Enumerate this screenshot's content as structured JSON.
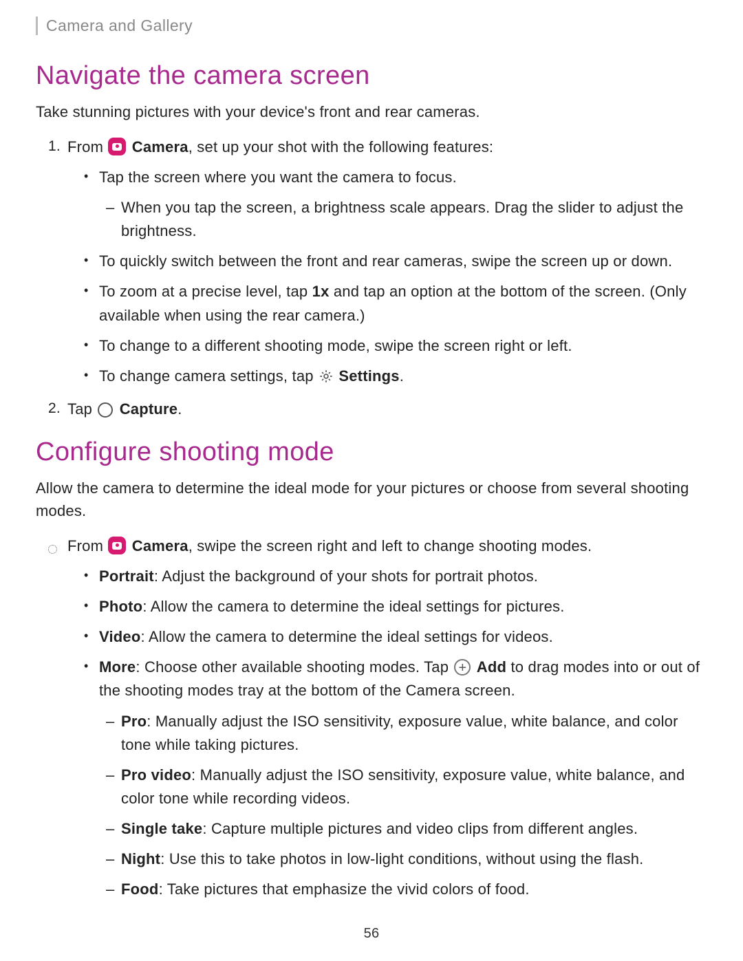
{
  "header": {
    "breadcrumb": "Camera and Gallery"
  },
  "section1": {
    "title": "Navigate the camera screen",
    "intro": "Take stunning pictures with your device's front and rear cameras.",
    "step1": {
      "prefix": "From ",
      "camera_label": "Camera",
      "suffix": ", set up your shot with the following features:",
      "b1": "Tap the screen where you want the camera to focus.",
      "b1_sub": "When you tap the screen, a brightness scale appears. Drag the slider to adjust the brightness.",
      "b2": "To quickly switch between the front and rear cameras, swipe the screen up or down.",
      "b3_pre": "To zoom at a precise level, tap ",
      "b3_bold": "1x",
      "b3_post": " and tap an option at the bottom of the screen. (Only available when using the rear camera.)",
      "b4": "To change to a different shooting mode, swipe the screen right or left.",
      "b5_pre": "To change camera settings, tap ",
      "b5_bold": "Settings",
      "b5_post": "."
    },
    "step2": {
      "prefix": "Tap ",
      "bold": "Capture",
      "post": "."
    }
  },
  "section2": {
    "title": "Configure shooting mode",
    "intro": "Allow the camera to determine the ideal mode for your pictures or choose from several shooting modes.",
    "lead": {
      "prefix": "From ",
      "camera_label": "Camera",
      "suffix": ", swipe the screen right and left to change shooting modes."
    },
    "modes": {
      "portrait_b": "Portrait",
      "portrait": ": Adjust the background of your shots for portrait photos.",
      "photo_b": "Photo",
      "photo": ": Allow the camera to determine the ideal settings for pictures.",
      "video_b": "Video",
      "video": ": Allow the camera to determine the ideal settings for videos.",
      "more_b": "More",
      "more_pre": ": Choose other available shooting modes. Tap ",
      "more_add": "Add",
      "more_post": " to drag modes into or out of the shooting modes tray at the bottom of the Camera screen.",
      "pro_b": "Pro",
      "pro": ": Manually adjust the ISO sensitivity, exposure value, white balance, and color tone while taking pictures.",
      "provideo_b": "Pro video",
      "provideo": ": Manually adjust the ISO sensitivity, exposure value, white balance, and color tone while recording videos.",
      "single_b": "Single take",
      "single": ": Capture multiple pictures and video clips from different angles.",
      "night_b": "Night",
      "night": ": Use this to take photos in low-light conditions, without using the flash.",
      "food_b": "Food",
      "food": ": Take pictures that emphasize the vivid colors of food."
    }
  },
  "page_number": "56"
}
